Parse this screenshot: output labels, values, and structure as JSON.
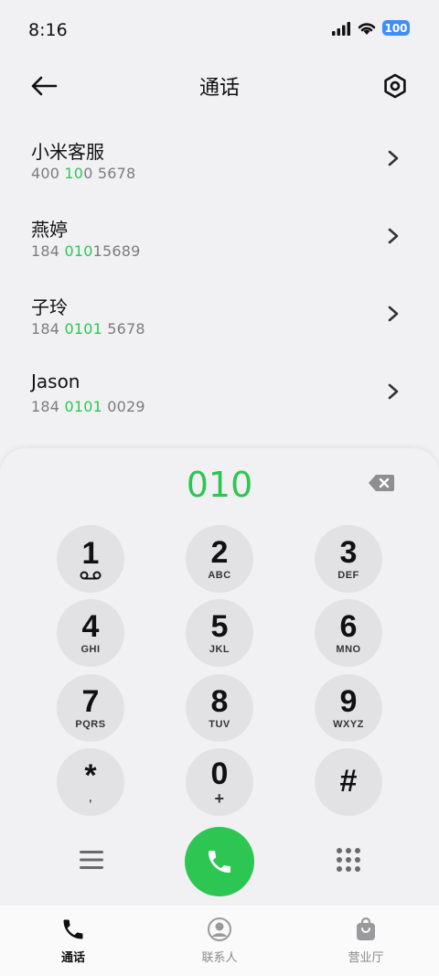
{
  "status_bar": {
    "time": "8:16",
    "battery": "100"
  },
  "header": {
    "title": "通话"
  },
  "contacts": [
    {
      "name": "小米客服",
      "number": [
        {
          "t": "400",
          "h": false
        },
        {
          "t": " 10",
          "h": true
        },
        {
          "t": "0 5678",
          "h": false
        }
      ]
    },
    {
      "name": "燕婷",
      "number": [
        {
          "t": "184 ",
          "h": false
        },
        {
          "t": "010",
          "h": true
        },
        {
          "t": "15689",
          "h": false
        }
      ]
    },
    {
      "name": "子玲",
      "number": [
        {
          "t": "184 ",
          "h": false
        },
        {
          "t": "0101",
          "h": true
        },
        {
          "t": " 5678",
          "h": false
        }
      ]
    },
    {
      "name": "Jason",
      "number": [
        {
          "t": "184 ",
          "h": false
        },
        {
          "t": "0101",
          "h": true
        },
        {
          "t": " 0029",
          "h": false
        }
      ]
    }
  ],
  "dialer": {
    "input": "010",
    "keys": [
      {
        "digit": "1",
        "letters": "",
        "voicemail": true
      },
      {
        "digit": "2",
        "letters": "ABC"
      },
      {
        "digit": "3",
        "letters": "DEF"
      },
      {
        "digit": "4",
        "letters": "GHI"
      },
      {
        "digit": "5",
        "letters": "JKL"
      },
      {
        "digit": "6",
        "letters": "MNO"
      },
      {
        "digit": "7",
        "letters": "PQRS"
      },
      {
        "digit": "8",
        "letters": "TUV"
      },
      {
        "digit": "9",
        "letters": "WXYZ"
      },
      {
        "digit": "*",
        "letters": ","
      },
      {
        "digit": "0",
        "letters": "+"
      },
      {
        "digit": "#",
        "letters": ""
      }
    ]
  },
  "nav": [
    {
      "label": "通话",
      "icon": "phone-icon",
      "active": true
    },
    {
      "label": "联系人",
      "icon": "contacts-icon",
      "active": false
    },
    {
      "label": "营业厅",
      "icon": "store-icon",
      "active": false
    }
  ],
  "colors": {
    "accent": "#2ec653",
    "background": "#f1f1f3",
    "key": "#e2e2e4",
    "battery": "#3e8ef7"
  }
}
